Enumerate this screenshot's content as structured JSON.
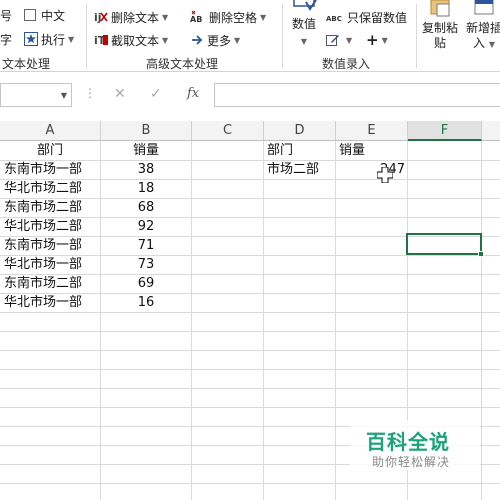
{
  "ribbon": {
    "left_items": [
      {
        "label": "号",
        "icon": "font-size-icon"
      },
      {
        "label": "字",
        "icon": "text-icon"
      }
    ],
    "chinese_checkbox_label": "中文",
    "execute_label": "执行",
    "group1_label": "文本处理",
    "delete_text_label": "删除文本",
    "extract_text_label": "截取文本",
    "delete_space_label": "删除空格",
    "delete_space_icon_text": "AB",
    "more_label": "更多",
    "group2_label": "高级文本处理",
    "number_value_label": "数值",
    "keep_numbers_label": "只保留数值",
    "keep_numbers_icon_text": "ABC",
    "group3_label": "数值录入",
    "copy_paste_label_line1": "复制粘",
    "copy_paste_label_line2": "贴",
    "new_insert_label_line1": "新增插",
    "new_insert_label_line2": "入",
    "plus_label": "+"
  },
  "formula_bar": {
    "fx_label": "fx",
    "cancel_label": "✕",
    "confirm_label": "✓",
    "dots_label": "⋮"
  },
  "sheet": {
    "columns": [
      "A",
      "B",
      "C",
      "D",
      "E",
      "F"
    ],
    "selected_column": "F",
    "headers_left": {
      "dept": "部门",
      "sales": "销量"
    },
    "rows": [
      {
        "dept": "东南市场一部",
        "sales": "38"
      },
      {
        "dept": "华北市场二部",
        "sales": "18"
      },
      {
        "dept": "东南市场二部",
        "sales": "68"
      },
      {
        "dept": "华北市场二部",
        "sales": "92"
      },
      {
        "dept": "东南市场一部",
        "sales": "71"
      },
      {
        "dept": "华北市场一部",
        "sales": "73"
      },
      {
        "dept": "东南市场二部",
        "sales": "69"
      },
      {
        "dept": "华北市场一部",
        "sales": "16"
      }
    ],
    "headers_right": {
      "dept": "部门",
      "sales": "销量"
    },
    "lookup_dept": "市场二部",
    "lookup_result": "247"
  },
  "watermark": {
    "title": "百科全说",
    "subtitle": "助你轻松解决"
  },
  "colors": {
    "accent_green": "#217346",
    "watermark_green": "#1aa37a"
  }
}
